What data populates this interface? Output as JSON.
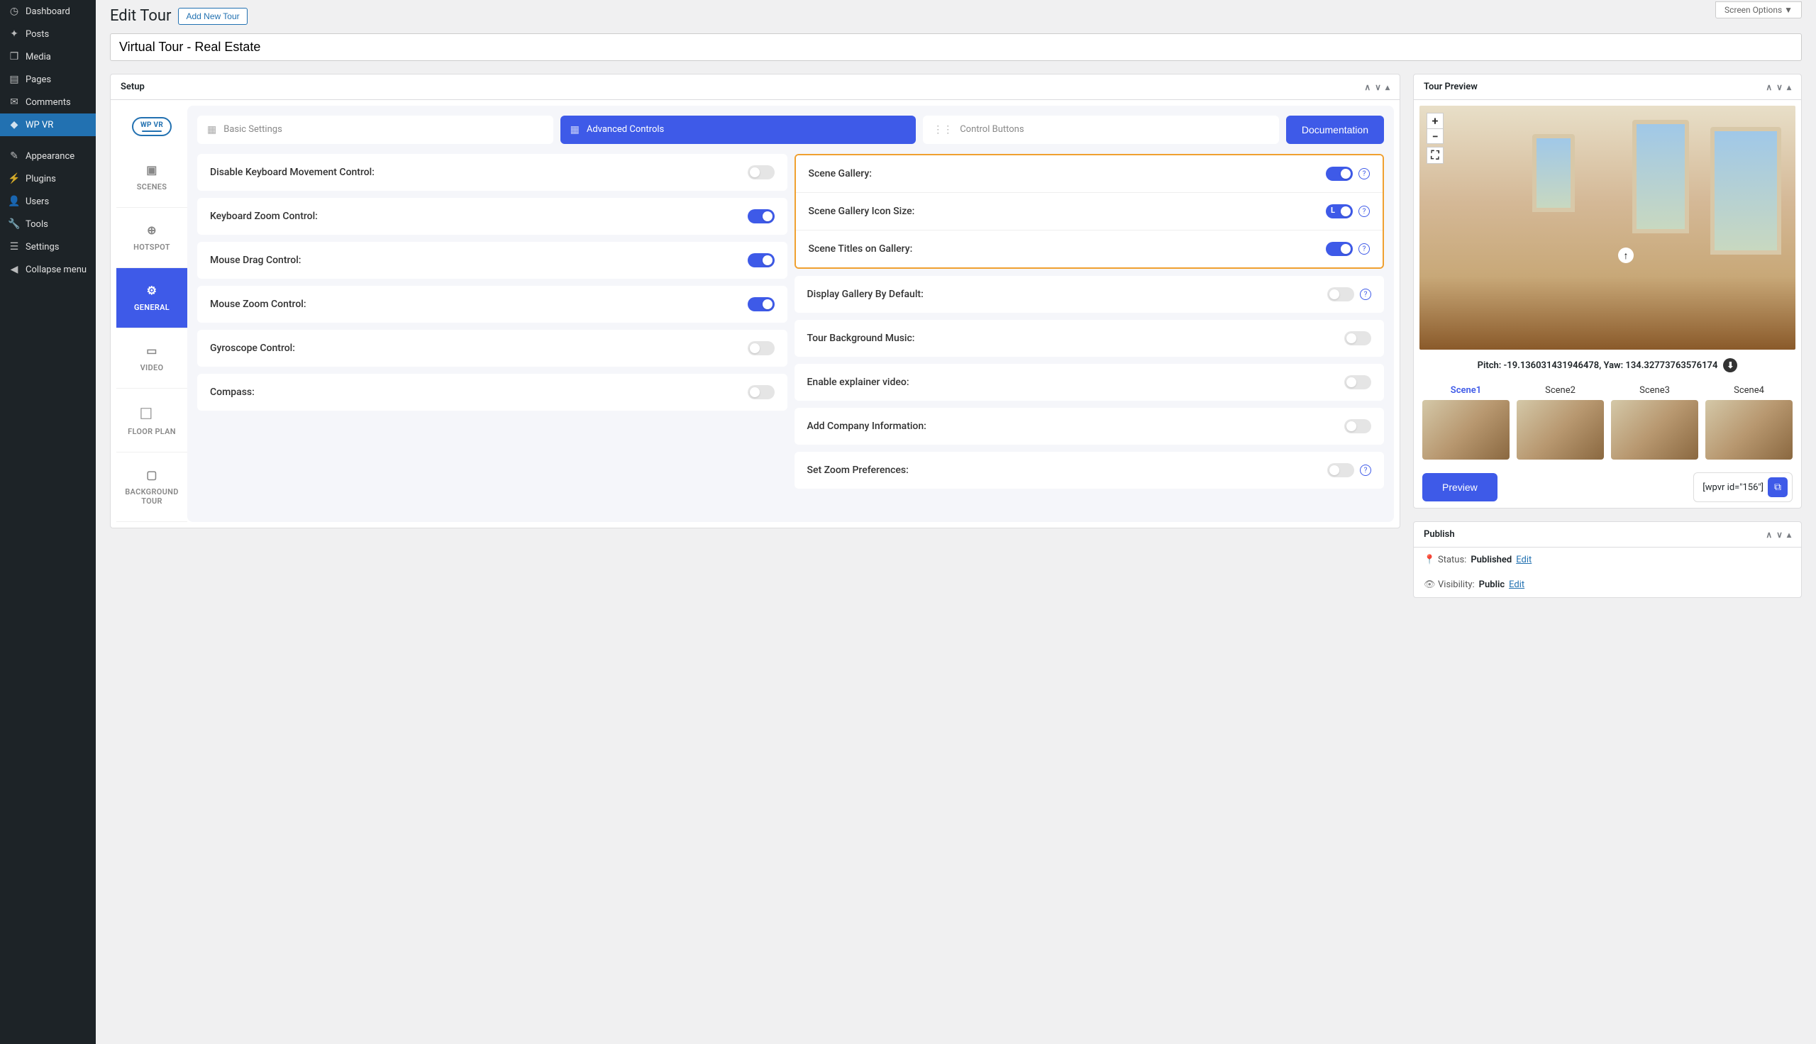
{
  "admin_sidebar": {
    "items": [
      {
        "icon": "⏱",
        "label": "Dashboard"
      },
      {
        "icon": "📌",
        "label": "Posts"
      },
      {
        "icon": "🎞",
        "label": "Media"
      },
      {
        "icon": "📄",
        "label": "Pages"
      },
      {
        "icon": "💬",
        "label": "Comments"
      },
      {
        "icon": "🔷",
        "label": "WP VR",
        "active": true
      }
    ],
    "items2": [
      {
        "icon": "🎨",
        "label": "Appearance"
      },
      {
        "icon": "🔌",
        "label": "Plugins"
      },
      {
        "icon": "👤",
        "label": "Users"
      },
      {
        "icon": "🔧",
        "label": "Tools"
      },
      {
        "icon": "⚙",
        "label": "Settings"
      },
      {
        "icon": "◀",
        "label": "Collapse menu"
      }
    ]
  },
  "header": {
    "page_title": "Edit Tour",
    "add_new_label": "Add New Tour",
    "screen_options": "Screen Options ▼",
    "title_value": "Virtual Tour - Real Estate"
  },
  "setup": {
    "box_title": "Setup",
    "logo_text": "WP VR",
    "side_tabs": [
      {
        "icon": "🖼",
        "label": "SCENES"
      },
      {
        "icon": "⊕",
        "label": "HOTSPOT"
      },
      {
        "icon": "⚙",
        "label": "GENERAL",
        "active": true
      },
      {
        "icon": "📹",
        "label": "VIDEO"
      },
      {
        "icon": "🗺",
        "label": "FLOOR PLAN"
      },
      {
        "icon": "⬚",
        "label": "BACKGROUND TOUR"
      }
    ],
    "sub_tabs": [
      {
        "icon": "▦",
        "label": "Basic Settings"
      },
      {
        "icon": "▦",
        "label": "Advanced Controls",
        "active": true
      },
      {
        "icon": "⋮⋮",
        "label": "Control Buttons"
      }
    ],
    "doc_label": "Documentation",
    "left_settings": [
      {
        "label": "Disable Keyboard Movement Control:",
        "on": false
      },
      {
        "label": "Keyboard Zoom Control:",
        "on": true
      },
      {
        "label": "Mouse Drag Control:",
        "on": true
      },
      {
        "label": "Mouse Zoom Control:",
        "on": true
      },
      {
        "label": "Gyroscope Control:",
        "on": false
      },
      {
        "label": "Compass:",
        "on": false
      }
    ],
    "right_settings_highlight": [
      {
        "label": "Scene Gallery:",
        "on": true,
        "info": true
      },
      {
        "label": "Scene Gallery Icon Size:",
        "l_pill": true,
        "info": true
      },
      {
        "label": "Scene Titles on Gallery:",
        "on": true,
        "info": true
      }
    ],
    "right_settings": [
      {
        "label": "Display Gallery By Default:",
        "on": false,
        "info": true
      },
      {
        "label": "Tour Background Music:",
        "on": false
      },
      {
        "label": "Enable explainer video:",
        "on": false
      },
      {
        "label": "Add Company Information:",
        "on": false
      },
      {
        "label": "Set Zoom Preferences:",
        "on": false,
        "info": true
      }
    ]
  },
  "preview": {
    "box_title": "Tour Preview",
    "zoom_in": "+",
    "zoom_out": "−",
    "fullscreen": "⛶",
    "pitch_yaw": "Pitch: -19.136031431946478, Yaw: 134.32773763576174",
    "scenes": [
      "Scene1",
      "Scene2",
      "Scene3",
      "Scene4"
    ],
    "preview_btn": "Preview",
    "shortcode": "[wpvr id=\"156\"]"
  },
  "publish": {
    "box_title": "Publish",
    "status_label": "Status:",
    "status_value": "Published",
    "visibility_label": "Visibility:",
    "visibility_value": "Public",
    "edit": "Edit"
  }
}
